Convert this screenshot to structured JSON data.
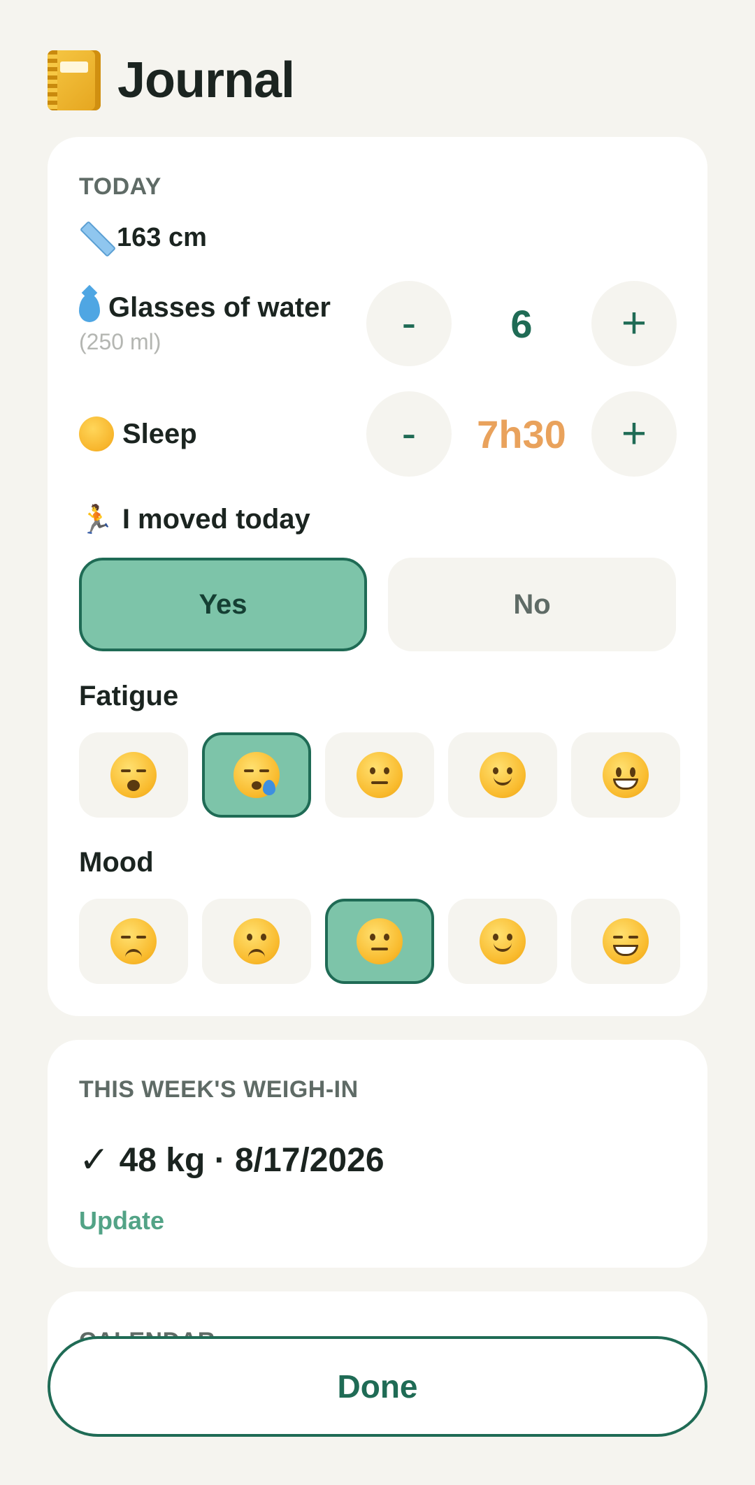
{
  "header": {
    "title": "Journal",
    "icon": "notebook-icon"
  },
  "today": {
    "section_label": "TODAY",
    "height": "163 cm",
    "water": {
      "label": "Glasses of water",
      "sublabel": "(250 ml)",
      "value": "6",
      "minus": "-",
      "plus": "+"
    },
    "sleep": {
      "label": "Sleep",
      "value": "7h30",
      "minus": "-",
      "plus": "+"
    },
    "moved": {
      "label": "I moved today",
      "yes": "Yes",
      "no": "No",
      "selected": "Yes"
    },
    "fatigue": {
      "label": "Fatigue",
      "options": [
        "weary",
        "sleepy",
        "neutral",
        "slight-smile",
        "smiley"
      ],
      "selected_index": 1
    },
    "mood": {
      "label": "Mood",
      "options": [
        "disappointed",
        "slightly-frowning",
        "neutral",
        "slight-smile",
        "grinning"
      ],
      "selected_index": 2
    }
  },
  "weigh_in": {
    "section_label": "THIS WEEK'S WEIGH-IN",
    "check": "✓",
    "value": "48 kg · 8/17/2026",
    "update_label": "Update"
  },
  "calendar": {
    "section_label": "CALENDAR"
  },
  "done_label": "Done",
  "colors": {
    "accent": "#1f6b55",
    "selected_fill": "#7dc4a9",
    "sleep_value": "#e9a25c",
    "background": "#f5f4ef"
  }
}
